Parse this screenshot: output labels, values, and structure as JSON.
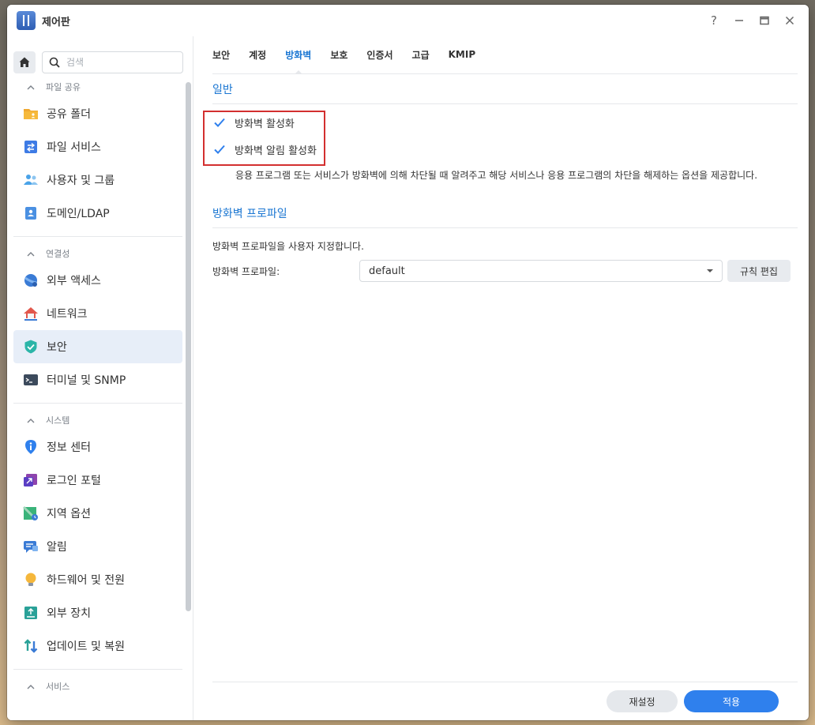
{
  "window": {
    "title": "제어판",
    "controls": [
      "?",
      "minimize",
      "maximize",
      "close"
    ]
  },
  "sidebar": {
    "search_placeholder": "검색",
    "sections": [
      {
        "header": "파일 공유",
        "items": [
          {
            "label": "공유 폴더",
            "icon": "shared-folder-icon"
          },
          {
            "label": "파일 서비스",
            "icon": "file-services-icon"
          },
          {
            "label": "사용자 및 그룹",
            "icon": "user-group-icon"
          },
          {
            "label": "도메인/LDAP",
            "icon": "domain-ldap-icon"
          }
        ]
      },
      {
        "header": "연결성",
        "items": [
          {
            "label": "외부 액세스",
            "icon": "external-access-icon"
          },
          {
            "label": "네트워크",
            "icon": "network-icon"
          },
          {
            "label": "보안",
            "icon": "security-shield-icon",
            "active": true
          },
          {
            "label": "터미널 및 SNMP",
            "icon": "terminal-icon"
          }
        ]
      },
      {
        "header": "시스템",
        "items": [
          {
            "label": "정보 센터",
            "icon": "info-center-icon"
          },
          {
            "label": "로그인 포털",
            "icon": "login-portal-icon"
          },
          {
            "label": "지역 옵션",
            "icon": "regional-options-icon"
          },
          {
            "label": "알림",
            "icon": "notification-icon"
          },
          {
            "label": "하드웨어 및 전원",
            "icon": "hardware-power-icon"
          },
          {
            "label": "외부 장치",
            "icon": "external-devices-icon"
          },
          {
            "label": "업데이트 및 복원",
            "icon": "update-restore-icon"
          }
        ]
      },
      {
        "header": "서비스",
        "items": []
      }
    ]
  },
  "tabs": [
    {
      "label": "보안"
    },
    {
      "label": "계정"
    },
    {
      "label": "방화벽",
      "active": true
    },
    {
      "label": "보호"
    },
    {
      "label": "인증서"
    },
    {
      "label": "고급"
    },
    {
      "label": "KMIP"
    }
  ],
  "general": {
    "title": "일반",
    "enable_firewall": {
      "label": "방화벽 활성화",
      "checked": true
    },
    "enable_notifications": {
      "label": "방화벽 알림 활성화",
      "checked": true
    },
    "description": "응용 프로그램 또는 서비스가 방화벽에 의해 차단될 때 알려주고 해당 서비스나 응용 프로그램의 차단을 해제하는 옵션을 제공합니다."
  },
  "profile": {
    "title": "방화벽 프로파일",
    "description": "방화벽 프로파일을 사용자 지정합니다.",
    "field_label": "방화벽 프로파일:",
    "selected": "default",
    "edit_rules_label": "규칙 편집"
  },
  "footer": {
    "reset_label": "재설정",
    "apply_label": "적용"
  },
  "colors": {
    "accent": "#2f80ed",
    "tab_active": "#1a76d2",
    "highlight": "#d32f2f"
  }
}
